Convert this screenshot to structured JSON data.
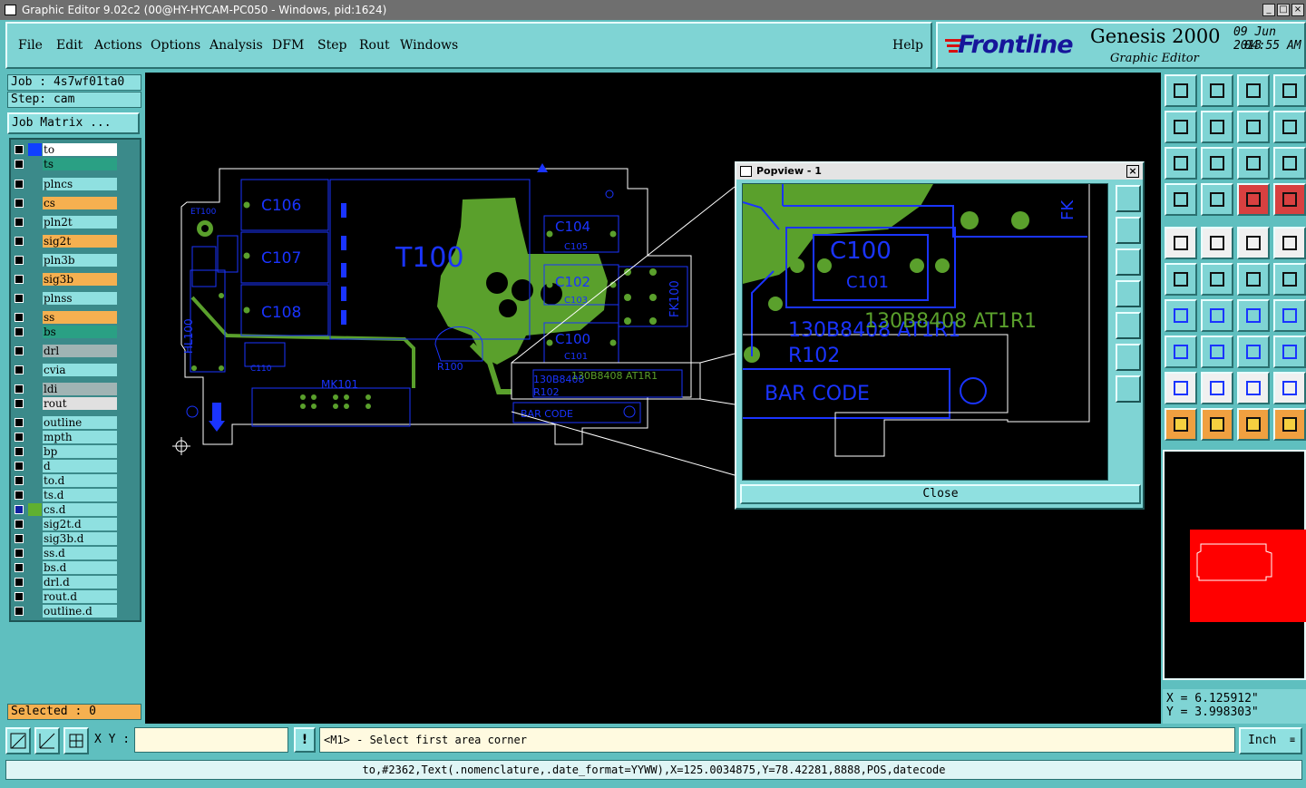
{
  "window": {
    "title": "Graphic Editor 9.02c2 (00@HY-HYCAM-PC050 - Windows, pid:1624)",
    "min_glyph": "_",
    "max_glyph": "□",
    "close_glyph": "×"
  },
  "menu": {
    "items": [
      "File",
      "Edit",
      "Actions",
      "Options",
      "Analysis",
      "DFM",
      "Step",
      "Rout",
      "Windows"
    ],
    "help": "Help"
  },
  "brand": {
    "logo": "Frontline",
    "product": "Genesis 2000",
    "subtitle": "Graphic Editor",
    "date": "09 Jun 2013",
    "time": "04:55 AM"
  },
  "job": {
    "job_label": "Job : 4s7wf01ta0",
    "step_label": "Step: cam",
    "matrix_button": "Job Matrix ...",
    "selected_label": "Selected : 0"
  },
  "layers": [
    {
      "name": "to",
      "color": "#ffffff",
      "swatch": "#1040ff",
      "checked": false
    },
    {
      "name": "ts",
      "color": "#2aa084",
      "swatch": "",
      "checked": false
    },
    {
      "name": "plncs",
      "color": "#8fe0e0",
      "swatch": "",
      "checked": false
    },
    {
      "name": "cs",
      "color": "#f5b050",
      "swatch": "",
      "checked": false
    },
    {
      "name": "pln2t",
      "color": "#8fe0e0",
      "swatch": "",
      "checked": false
    },
    {
      "name": "sig2t",
      "color": "#f5b050",
      "swatch": "",
      "checked": false
    },
    {
      "name": "pln3b",
      "color": "#8fe0e0",
      "swatch": "",
      "checked": false
    },
    {
      "name": "sig3b",
      "color": "#f5b050",
      "swatch": "",
      "checked": false
    },
    {
      "name": "plnss",
      "color": "#8fe0e0",
      "swatch": "",
      "checked": false
    },
    {
      "name": "ss",
      "color": "#f5b050",
      "swatch": "",
      "checked": false
    },
    {
      "name": "bs",
      "color": "#2aa084",
      "swatch": "",
      "checked": false
    },
    {
      "name": "drl",
      "color": "#a0b4b4",
      "swatch": "",
      "checked": false
    },
    {
      "name": "cvia",
      "color": "#8fe0e0",
      "swatch": "",
      "checked": false
    },
    {
      "name": "ldi",
      "color": "#a0b4b4",
      "swatch": "",
      "checked": false
    },
    {
      "name": "rout",
      "color": "#e0e0e0",
      "swatch": "",
      "checked": false
    },
    {
      "name": "outline",
      "color": "#8fe0e0",
      "swatch": "",
      "checked": false
    },
    {
      "name": "mpth",
      "color": "#8fe0e0",
      "swatch": "",
      "checked": false
    },
    {
      "name": "bp",
      "color": "#8fe0e0",
      "swatch": "",
      "checked": false
    },
    {
      "name": "d",
      "color": "#8fe0e0",
      "swatch": "",
      "checked": false
    },
    {
      "name": "to.d",
      "color": "#8fe0e0",
      "swatch": "",
      "checked": false
    },
    {
      "name": "ts.d",
      "color": "#8fe0e0",
      "swatch": "",
      "checked": false
    },
    {
      "name": "cs.d",
      "color": "#8fe0e0",
      "swatch": "#60b030",
      "checked": true
    },
    {
      "name": "sig2t.d",
      "color": "#8fe0e0",
      "swatch": "",
      "checked": false
    },
    {
      "name": "sig3b.d",
      "color": "#8fe0e0",
      "swatch": "",
      "checked": false
    },
    {
      "name": "ss.d",
      "color": "#8fe0e0",
      "swatch": "",
      "checked": false
    },
    {
      "name": "bs.d",
      "color": "#8fe0e0",
      "swatch": "",
      "checked": false
    },
    {
      "name": "drl.d",
      "color": "#8fe0e0",
      "swatch": "",
      "checked": false
    },
    {
      "name": "rout.d",
      "color": "#8fe0e0",
      "swatch": "",
      "checked": false
    },
    {
      "name": "outline.d",
      "color": "#8fe0e0",
      "swatch": "",
      "checked": false
    }
  ],
  "board": {
    "labels": {
      "t100": "T100",
      "c106": "C106",
      "c107": "C107",
      "c108": "C108",
      "c104": "C104",
      "c105": "C105",
      "c102": "C102",
      "c103": "C103",
      "c100": "C100",
      "c101": "C101",
      "c110": "C110",
      "mk101": "MK101",
      "et100": "ET100",
      "fk100": "FK100",
      "hl100": "HL100",
      "r100": "R100",
      "r102": "R102",
      "code_blue": "130B8408",
      "code_green": "130B8408  AT1R1",
      "barcode": "BAR CODE"
    },
    "colors": {
      "outline": "#ffffff",
      "silk": "#1a34ff",
      "copper": "#5aa02c"
    }
  },
  "popview": {
    "title": "Popview - 1",
    "close_label": "Close",
    "labels": {
      "c100": "C100",
      "c101": "C101",
      "code_blue": "130B8408 AT1R1",
      "code_green": "130B8408  AT1R1",
      "r102": "R102",
      "barcode": "BAR  CODE",
      "fk": "FK"
    }
  },
  "coords": {
    "x": "X = 6.125912\"",
    "y": "Y = 3.998303\""
  },
  "bottom": {
    "xy_label": "X Y :",
    "xy_value": "",
    "prompt": "<M1> - Select first area corner",
    "unit": "Inch",
    "status": "to,#2362,Text(.nomenclature,.date_format=YYWW),X=125.0034875,Y=78.42281,8888,POS,datecode"
  }
}
